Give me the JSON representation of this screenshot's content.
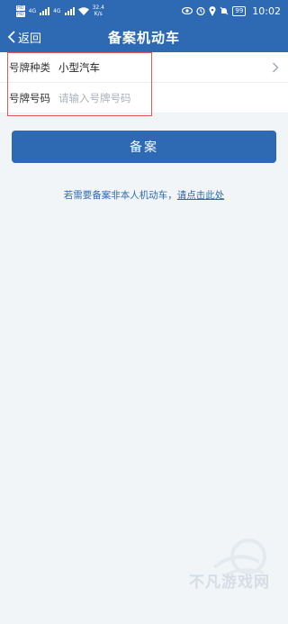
{
  "status_bar": {
    "sim_labels": [
      "HD",
      "HD"
    ],
    "network": "4G",
    "network2": "4G",
    "speed_value": "32.4",
    "speed_unit": "K/s",
    "battery": "99",
    "time": "10:02"
  },
  "nav": {
    "back_label": "返回",
    "title": "备案机动车"
  },
  "form": {
    "plate_type_label": "号牌种类",
    "plate_type_value": "小型汽车",
    "plate_number_label": "号牌号码",
    "plate_number_value": "",
    "plate_number_placeholder": "请输入号牌号码"
  },
  "submit_label": "备案",
  "hint": {
    "text": "若需要备案非本人机动车，",
    "link": "请点击此处"
  },
  "watermark_text": "不凡游戏网",
  "colors": {
    "brand": "#2e6ab3",
    "background": "#f2f5f8",
    "highlight": "#e25858"
  }
}
